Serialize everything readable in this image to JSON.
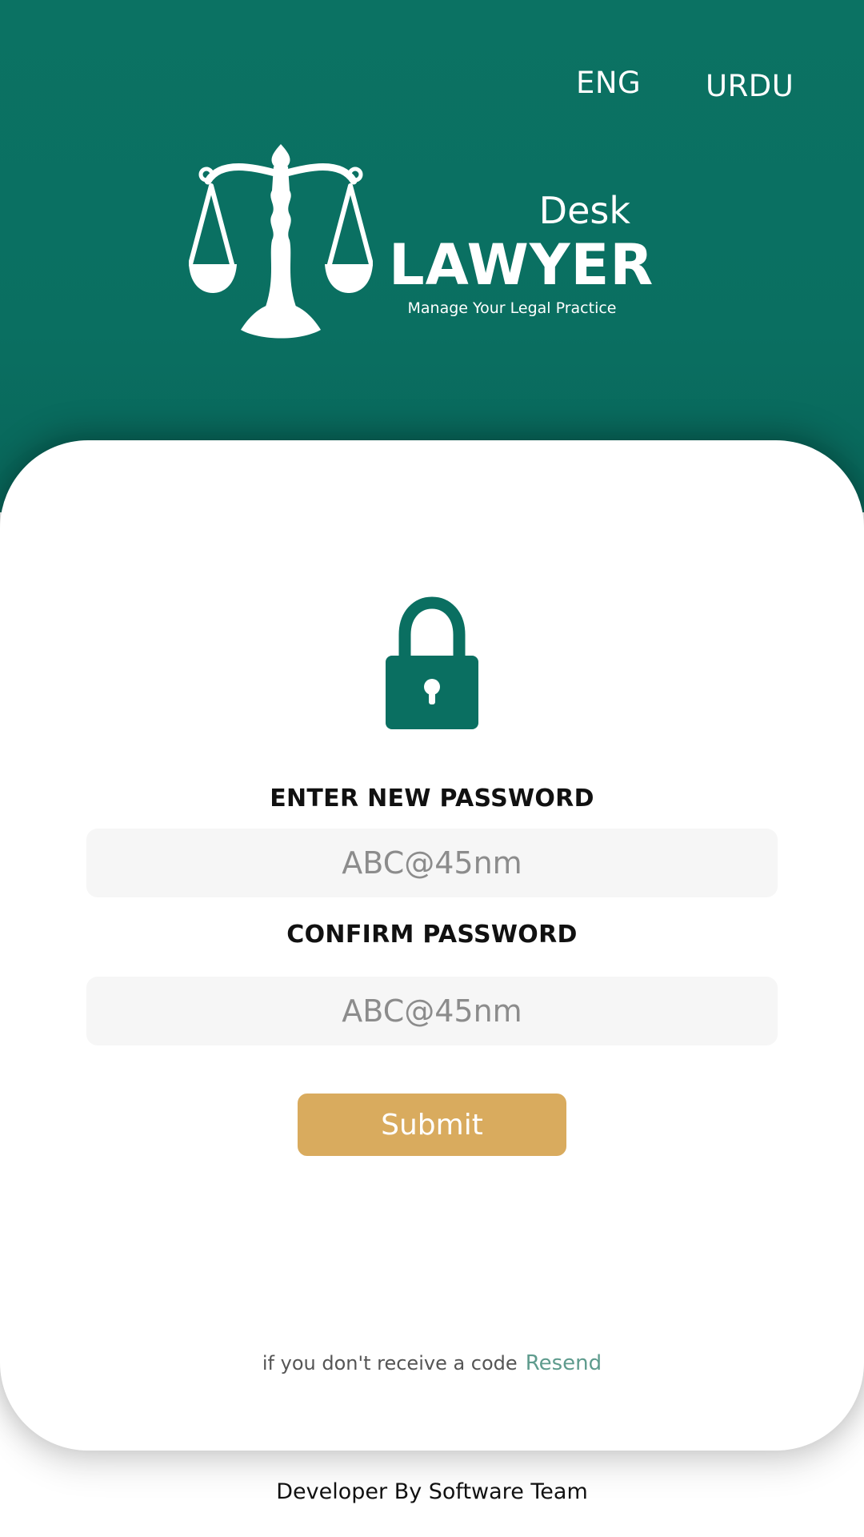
{
  "header": {
    "languages": {
      "eng": "ENG",
      "urdu": "URDU"
    },
    "logo": {
      "desk": "Desk",
      "lawyer": "LAWYER",
      "tagline": "Manage Your Legal Practice",
      "icon": "scales-of-justice-icon"
    }
  },
  "form": {
    "icon": "lock-icon",
    "new_password_label": "ENTER NEW PASSWORD",
    "new_password_placeholder": "ABC@45nm",
    "confirm_password_label": "CONFIRM PASSWORD",
    "confirm_password_placeholder": "ABC@45nm",
    "submit_label": "Submit"
  },
  "resend": {
    "text": "if you don't receive a code",
    "link": "Resend"
  },
  "footer": {
    "text": "Developer By Software Team"
  },
  "colors": {
    "primary": "#0a6f61",
    "accent": "#d9ab5e",
    "link": "#5e9b8d"
  }
}
